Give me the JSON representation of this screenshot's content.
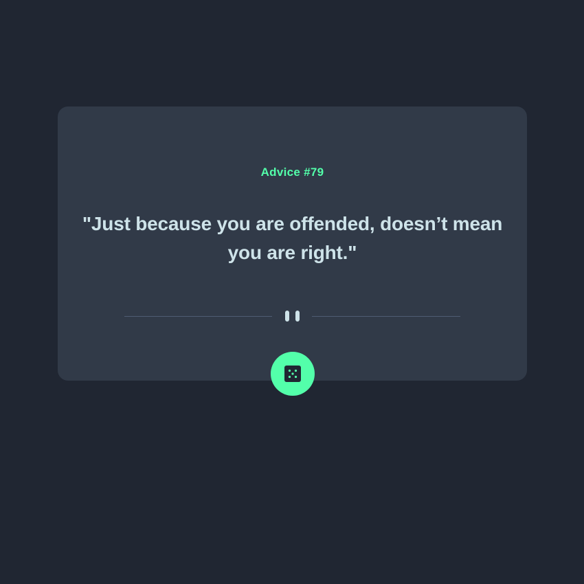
{
  "advice": {
    "id_label": "Advice #79",
    "text": "\"Just because you are offended, doesn’t mean you are right.\""
  },
  "divider": {
    "icon": "pause-icon"
  },
  "dice_button": {
    "icon": "dice-icon"
  },
  "colors": {
    "background": "#202632",
    "card": "#313a48",
    "accent": "#53ffaa",
    "text": "#cee3e9",
    "divider_line": "#4f5d74"
  }
}
